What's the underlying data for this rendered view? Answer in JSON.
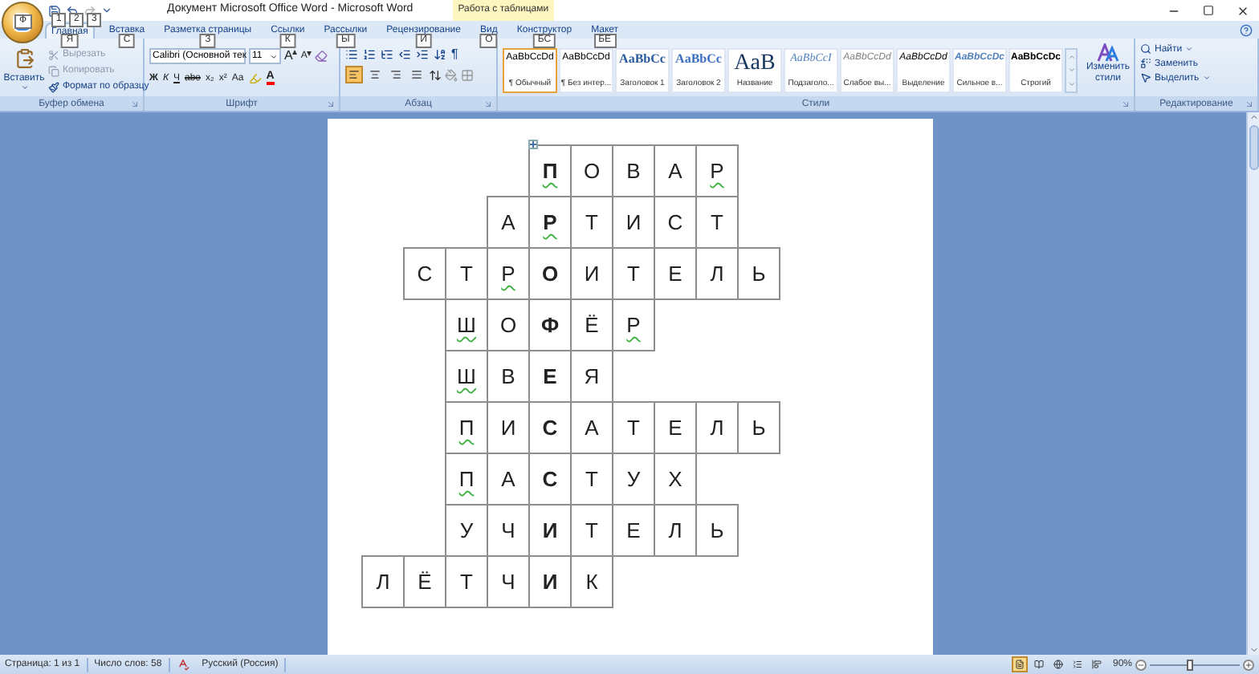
{
  "title_bar": {
    "office_button_keytip": "Ф",
    "quick_access": [
      {
        "kind": "save",
        "keytip": "1",
        "disabled": false
      },
      {
        "kind": "undo",
        "keytip": "2",
        "disabled": false
      },
      {
        "kind": "redo",
        "keytip": "3",
        "disabled": true
      }
    ],
    "title": "Документ Microsoft Office Word - Microsoft Word",
    "contextual_group": "Работа с таблицами"
  },
  "tabs": [
    {
      "label": "Главная",
      "keytip": "Я",
      "selected": true
    },
    {
      "label": "Вставка",
      "keytip": "С",
      "selected": false
    },
    {
      "label": "Разметка страницы",
      "keytip": "З",
      "selected": false
    },
    {
      "label": "Ссылки",
      "keytip": "К",
      "selected": false
    },
    {
      "label": "Рассылки",
      "keytip": "Ы",
      "selected": false
    },
    {
      "label": "Рецензирование",
      "keytip": "И",
      "selected": false
    },
    {
      "label": "Вид",
      "keytip": "О",
      "selected": false
    },
    {
      "label": "Конструктор",
      "keytip": "БС",
      "selected": false
    },
    {
      "label": "Макет",
      "keytip": "БЕ",
      "selected": false
    }
  ],
  "clipboard": {
    "label": "Буфер обмена",
    "paste": "Вставить",
    "items": [
      {
        "kind": "cut",
        "label": "Вырезать",
        "disabled": true
      },
      {
        "kind": "copy",
        "label": "Копировать",
        "disabled": true
      },
      {
        "kind": "format",
        "label": "Формат по образцу",
        "disabled": false
      }
    ]
  },
  "font": {
    "label": "Шрифт",
    "font_name": "Calibri (Основной тек",
    "font_size": "11",
    "grow": "A",
    "shrink": "A",
    "format_buttons": [
      {
        "label": "Ж",
        "kind": "bold"
      },
      {
        "label": "К",
        "kind": "italic"
      },
      {
        "label": "Ч",
        "kind": "underline"
      },
      {
        "label": "abe",
        "kind": "strike"
      },
      {
        "label": "x₂",
        "kind": "plain"
      },
      {
        "label": "x²",
        "kind": "plain"
      },
      {
        "label": "Аа",
        "kind": "plain"
      }
    ],
    "font_color": "A"
  },
  "paragraph": {
    "label": "Абзац",
    "show_marks": "¶",
    "alignments": [
      {
        "kind": "left",
        "selected": true
      },
      {
        "kind": "center",
        "selected": false
      },
      {
        "kind": "right",
        "selected": false
      },
      {
        "kind": "justify",
        "selected": false
      }
    ]
  },
  "styles": {
    "label": "Стили",
    "gallery": [
      {
        "preview": "AaBbCcDd",
        "name": "¶ Обычный",
        "kind": "normal",
        "selected": true
      },
      {
        "preview": "AaBbCcDd",
        "name": "¶ Без интер...",
        "kind": "normal",
        "selected": false
      },
      {
        "preview": "AaBbCc",
        "name": "Заголовок 1",
        "kind": "heading",
        "selected": false
      },
      {
        "preview": "AaBbCc",
        "name": "Заголовок 2",
        "kind": "heading2",
        "selected": false
      },
      {
        "preview": "AaB",
        "name": "Название",
        "kind": "title",
        "selected": false
      },
      {
        "preview": "AaBbCcI",
        "name": "Подзаголо...",
        "kind": "subtitle",
        "selected": false
      },
      {
        "preview": "AaBbCcDd",
        "name": "Слабое вы...",
        "kind": "subtle",
        "selected": false
      },
      {
        "preview": "AaBbCcDd",
        "name": "Выделение",
        "kind": "emphasis",
        "selected": false
      },
      {
        "preview": "AaBbCcDc",
        "name": "Сильное в...",
        "kind": "intense",
        "selected": false
      },
      {
        "preview": "AaBbCcDc",
        "name": "Строгий",
        "kind": "strong",
        "selected": false
      }
    ],
    "change_styles": "Изменить стили"
  },
  "editing": {
    "label": "Редактирование",
    "items": [
      {
        "kind": "find",
        "label": "Найти",
        "dropdown": true
      },
      {
        "kind": "replace",
        "label": "Заменить",
        "dropdown": false
      },
      {
        "kind": "select",
        "label": "Выделить",
        "dropdown": true
      }
    ]
  },
  "crossword": [
    {
      "cells": [
        {
          "text": "П",
          "key": true,
          "flagged": true
        },
        {
          "text": "О",
          "key": false,
          "flagged": false
        },
        {
          "text": "В",
          "key": false,
          "flagged": false
        },
        {
          "text": "А",
          "key": false,
          "flagged": false
        },
        {
          "text": "Р",
          "key": false,
          "flagged": true
        }
      ]
    },
    {
      "cells": [
        {
          "text": "А",
          "key": false,
          "flagged": false
        },
        {
          "text": "Р",
          "key": true,
          "flagged": true
        },
        {
          "text": "Т",
          "key": false,
          "flagged": false
        },
        {
          "text": "И",
          "key": false,
          "flagged": false
        },
        {
          "text": "С",
          "key": false,
          "flagged": false
        },
        {
          "text": "Т",
          "key": false,
          "flagged": false
        }
      ]
    },
    {
      "cells": [
        {
          "text": "С",
          "key": false,
          "flagged": false
        },
        {
          "text": "Т",
          "key": false,
          "flagged": false
        },
        {
          "text": "Р",
          "key": false,
          "flagged": true
        },
        {
          "text": "О",
          "key": true,
          "flagged": false
        },
        {
          "text": "И",
          "key": false,
          "flagged": false
        },
        {
          "text": "Т",
          "key": false,
          "flagged": false
        },
        {
          "text": "Е",
          "key": false,
          "flagged": false
        },
        {
          "text": "Л",
          "key": false,
          "flagged": false
        },
        {
          "text": "Ь",
          "key": false,
          "flagged": false
        }
      ]
    },
    {
      "cells": [
        {
          "text": "Ш",
          "key": false,
          "flagged": true
        },
        {
          "text": "О",
          "key": false,
          "flagged": false
        },
        {
          "text": "Ф",
          "key": true,
          "flagged": false
        },
        {
          "text": "Ё",
          "key": false,
          "flagged": false
        },
        {
          "text": "Р",
          "key": false,
          "flagged": true
        }
      ]
    },
    {
      "cells": [
        {
          "text": "Ш",
          "key": false,
          "flagged": true
        },
        {
          "text": "В",
          "key": false,
          "flagged": false
        },
        {
          "text": "Е",
          "key": true,
          "flagged": false
        },
        {
          "text": "Я",
          "key": false,
          "flagged": false
        }
      ]
    },
    {
      "cells": [
        {
          "text": "П",
          "key": false,
          "flagged": true
        },
        {
          "text": "И",
          "key": false,
          "flagged": false
        },
        {
          "text": "С",
          "key": true,
          "flagged": false
        },
        {
          "text": "А",
          "key": false,
          "flagged": false
        },
        {
          "text": "Т",
          "key": false,
          "flagged": false
        },
        {
          "text": "Е",
          "key": false,
          "flagged": false
        },
        {
          "text": "Л",
          "key": false,
          "flagged": false
        },
        {
          "text": "Ь",
          "key": false,
          "flagged": false
        }
      ]
    },
    {
      "cells": [
        {
          "text": "П",
          "key": false,
          "flagged": true
        },
        {
          "text": "А",
          "key": false,
          "flagged": false
        },
        {
          "text": "С",
          "key": true,
          "flagged": false
        },
        {
          "text": "Т",
          "key": false,
          "flagged": false
        },
        {
          "text": "У",
          "key": false,
          "flagged": false
        },
        {
          "text": "Х",
          "key": false,
          "flagged": false
        }
      ]
    },
    {
      "cells": [
        {
          "text": "У",
          "key": false,
          "flagged": false
        },
        {
          "text": "Ч",
          "key": false,
          "flagged": false
        },
        {
          "text": "И",
          "key": true,
          "flagged": false
        },
        {
          "text": "Т",
          "key": false,
          "flagged": false
        },
        {
          "text": "Е",
          "key": false,
          "flagged": false
        },
        {
          "text": "Л",
          "key": false,
          "flagged": false
        },
        {
          "text": "Ь",
          "key": false,
          "flagged": false
        }
      ]
    },
    {
      "cells": [
        {
          "text": "Л",
          "key": false,
          "flagged": false
        },
        {
          "text": "Ё",
          "key": false,
          "flagged": false
        },
        {
          "text": "Т",
          "key": false,
          "flagged": false
        },
        {
          "text": "Ч",
          "key": false,
          "flagged": false
        },
        {
          "text": "И",
          "key": true,
          "flagged": false
        },
        {
          "text": "К",
          "key": false,
          "flagged": false
        }
      ]
    }
  ],
  "status_bar": {
    "page": "Страница: 1 из 1",
    "words": "Число слов: 58",
    "language": "Русский (Россия)",
    "views": [
      {
        "kind": "print",
        "selected": true
      },
      {
        "kind": "reading",
        "selected": false
      },
      {
        "kind": "web",
        "selected": false
      },
      {
        "kind": "outline",
        "selected": false
      },
      {
        "kind": "draft",
        "selected": false
      }
    ],
    "zoom": "90%",
    "zoom_slider": {
      "level": 0.45
    }
  }
}
